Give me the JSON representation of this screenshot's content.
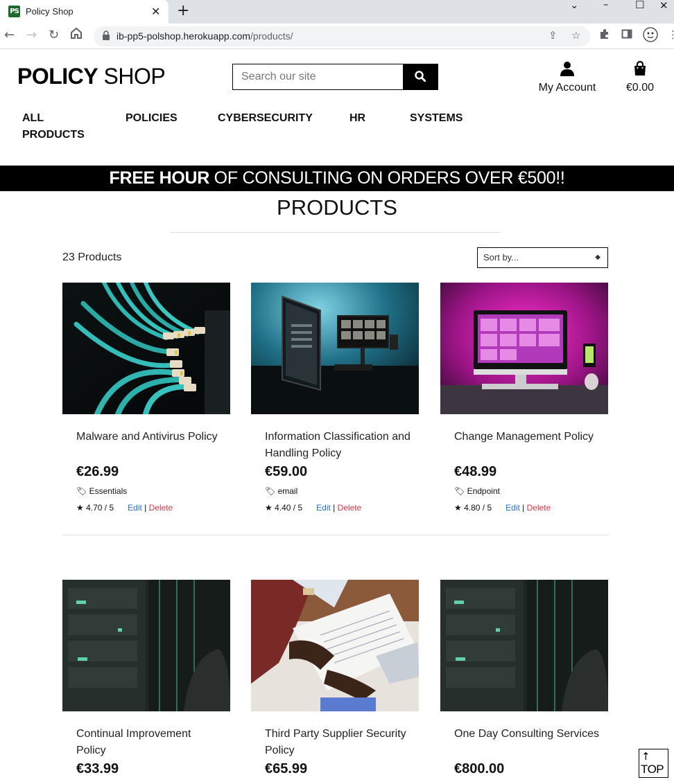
{
  "browser": {
    "tab_title": "Policy Shop",
    "favicon_text": "PS",
    "url_host": "ib-pp5-polshop.herokuapp.com",
    "url_path": "/products/"
  },
  "header": {
    "logo_bold": "POLICY",
    "logo_light": " SHOP",
    "search_placeholder": "Search our site",
    "account_label": "My Account",
    "cart_total": "€0.00"
  },
  "nav": [
    {
      "label": "ALL\nPRODUCTS"
    },
    {
      "label": "POLICIES"
    },
    {
      "label": "CYBERSECURITY"
    },
    {
      "label": "HR"
    },
    {
      "label": "SYSTEMS"
    }
  ],
  "banner": {
    "bold": "FREE HOUR",
    "rest": " OF CONSULTING ON ORDERS OVER €500!!"
  },
  "page": {
    "title": "PRODUCTS",
    "count": "23 Products",
    "sort_label": "Sort by..."
  },
  "products": [
    {
      "name": "Malware and Antivirus Policy",
      "price": "€26.99",
      "category": "Essentials",
      "rating": "4.70 / 5",
      "edit": "Edit",
      "delete": "Delete"
    },
    {
      "name": "Information Classification and Handling Policy",
      "price": "€59.00",
      "category": "email",
      "rating": "4.40 / 5",
      "edit": "Edit",
      "delete": "Delete"
    },
    {
      "name": "Change Management Policy",
      "price": "€48.99",
      "category": "Endpoint",
      "rating": "4.80 / 5",
      "edit": "Edit",
      "delete": "Delete"
    },
    {
      "name": "Continual Improvement Policy",
      "price": "€33.99"
    },
    {
      "name": "Third Party Supplier Security Policy",
      "price": "€65.99"
    },
    {
      "name": "One Day Consulting Services",
      "price": "€800.00"
    }
  ],
  "top_button": {
    "arrow": "↑",
    "label": "TOP"
  }
}
